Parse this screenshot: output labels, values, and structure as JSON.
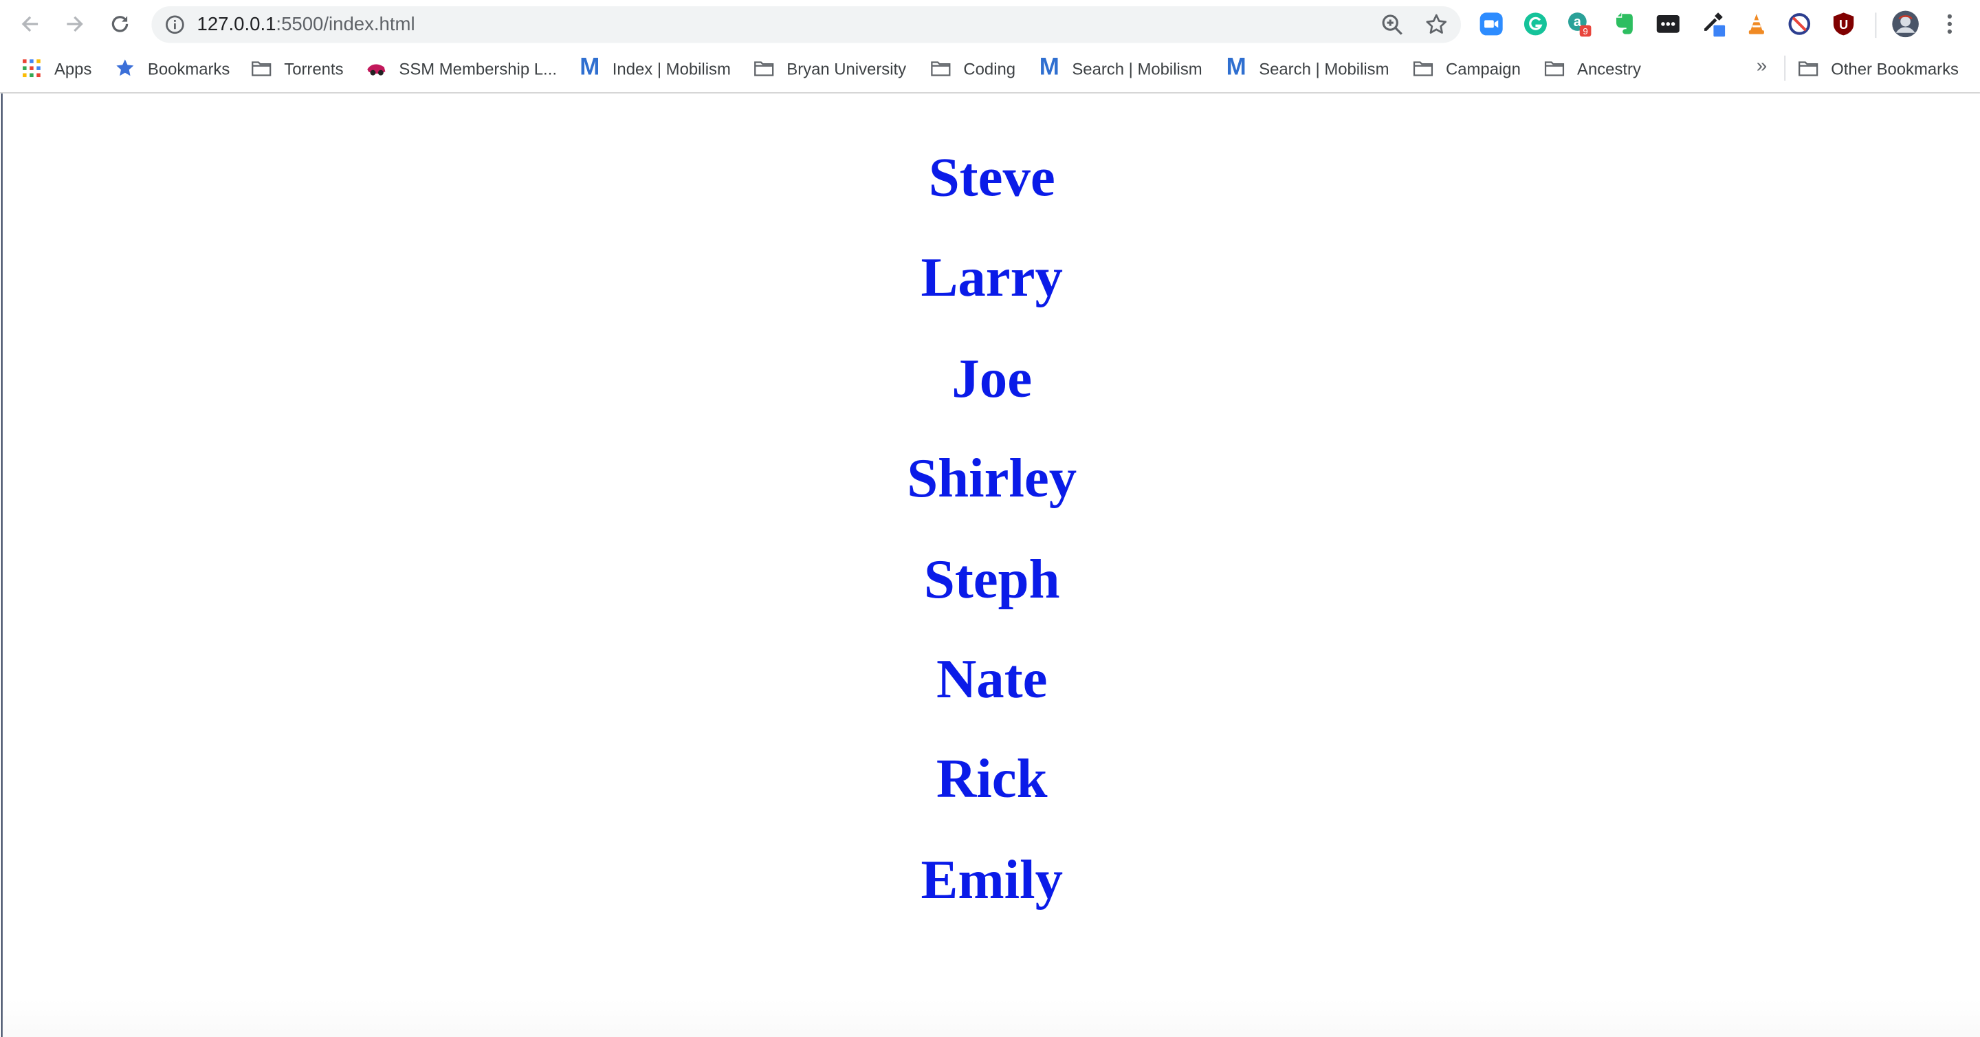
{
  "browser": {
    "url_host": "127.0.0.1",
    "url_rest": ":5500/index.html",
    "extension_badge": "9",
    "extension_u_label": "U"
  },
  "bookmarks": {
    "items": [
      {
        "label": "Apps",
        "icon": "apps-grid-icon"
      },
      {
        "label": "Bookmarks",
        "icon": "star-icon"
      },
      {
        "label": "Torrents",
        "icon": "folder-icon"
      },
      {
        "label": "SSM Membership L...",
        "icon": "site-favicon"
      },
      {
        "label": "Index | Mobilism",
        "icon": "mobilism-m-icon"
      },
      {
        "label": "Bryan University",
        "icon": "folder-icon"
      },
      {
        "label": "Coding",
        "icon": "folder-icon"
      },
      {
        "label": "Search | Mobilism",
        "icon": "mobilism-m-icon"
      },
      {
        "label": "Search | Mobilism",
        "icon": "mobilism-m-icon"
      },
      {
        "label": "Campaign",
        "icon": "folder-icon"
      },
      {
        "label": "Ancestry",
        "icon": "folder-icon"
      }
    ],
    "overflow_label": "»",
    "other_label": "Other Bookmarks",
    "mobilism_letter": "M"
  },
  "page": {
    "names": [
      "Steve",
      "Larry",
      "Joe",
      "Shirley",
      "Steph",
      "Nate",
      "Rick",
      "Emily"
    ],
    "name_color": "#0a1be8"
  }
}
